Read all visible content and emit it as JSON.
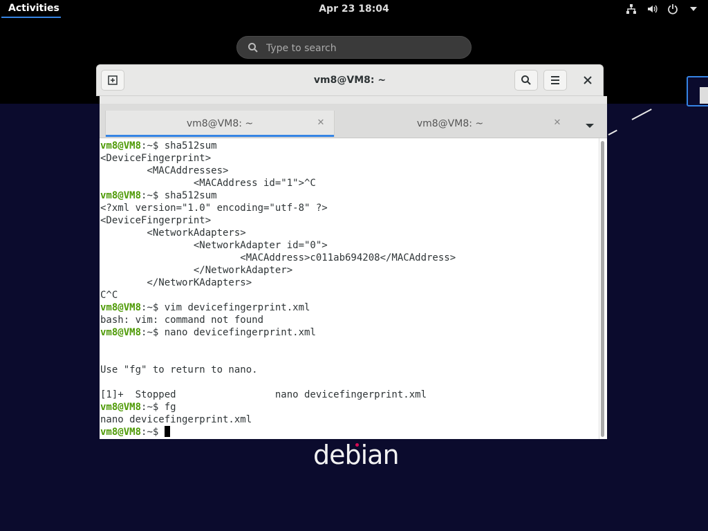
{
  "topbar": {
    "activities": "Activities",
    "clock": "Apr 23  18:04"
  },
  "search": {
    "placeholder": "Type to search"
  },
  "window": {
    "title": "vm8@VM8: ~",
    "tabs": [
      {
        "label": "vm8@VM8: ~",
        "active": true
      },
      {
        "label": "vm8@VM8: ~",
        "active": false
      }
    ]
  },
  "wallpaper": {
    "logo": "debian"
  },
  "terminal": {
    "lines": [
      {
        "user": "vm8@VM8",
        "rest": ":~$ sha512sum"
      },
      {
        "text": "<DeviceFingerprint>"
      },
      {
        "text": "        <MACAddresses>"
      },
      {
        "text": "                <MACAddress id=\"1\">^C"
      },
      {
        "user": "vm8@VM8",
        "rest": ":~$ sha512sum"
      },
      {
        "text": "<?xml version=\"1.0\" encoding=\"utf-8\" ?>"
      },
      {
        "text": "<DeviceFingerprint>"
      },
      {
        "text": "        <NetworkAdapters>"
      },
      {
        "text": "                <NetworkAdapter id=\"0\">"
      },
      {
        "text": "                        <MACAddress>c011ab694208</MACAddress>"
      },
      {
        "text": "                </NetworkAdapter>"
      },
      {
        "text": "        </NetworKAdapters>"
      },
      {
        "text": "C^C"
      },
      {
        "user": "vm8@VM8",
        "rest": ":~$ vim devicefingerprint.xml"
      },
      {
        "text": "bash: vim: command not found"
      },
      {
        "user": "vm8@VM8",
        "rest": ":~$ nano devicefingerprint.xml"
      },
      {
        "text": ""
      },
      {
        "text": ""
      },
      {
        "text": "Use \"fg\" to return to nano."
      },
      {
        "text": ""
      },
      {
        "text": "[1]+  Stopped                 nano devicefingerprint.xml"
      },
      {
        "user": "vm8@VM8",
        "rest": ":~$ fg"
      },
      {
        "text": "nano devicefingerprint.xml"
      },
      {
        "user": "vm8@VM8",
        "rest": ":~$ "
      }
    ]
  }
}
